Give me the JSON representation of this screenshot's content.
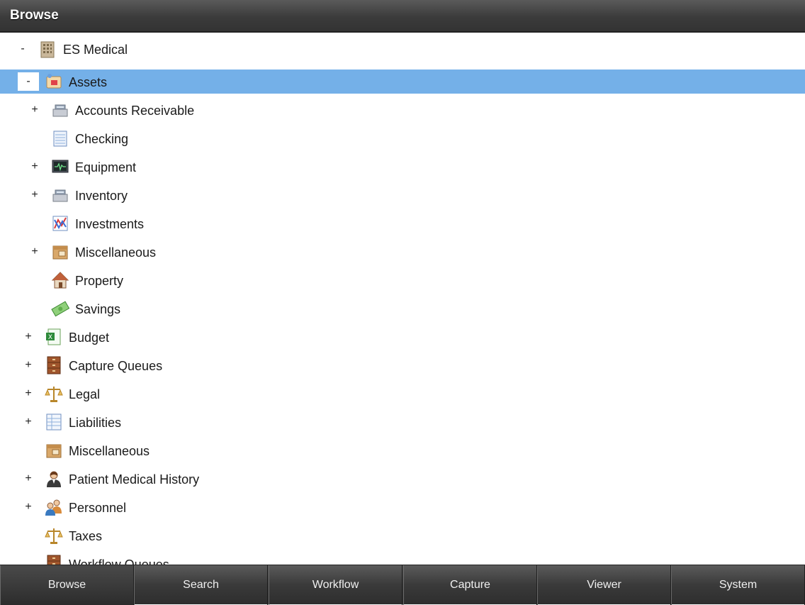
{
  "header": {
    "title": "Browse"
  },
  "tree": {
    "root": {
      "label": "ES Medical",
      "toggle": "-",
      "icon": "building-icon"
    },
    "items": [
      {
        "label": "Assets",
        "toggle": "-",
        "icon": "assets-icon",
        "selected": true
      },
      {
        "label": "Accounts Receivable",
        "toggle": "+",
        "icon": "cash-register-icon"
      },
      {
        "label": "Checking",
        "toggle": "",
        "icon": "ledger-icon"
      },
      {
        "label": "Equipment",
        "toggle": "+",
        "icon": "monitor-icon"
      },
      {
        "label": "Inventory",
        "toggle": "+",
        "icon": "cash-register-icon"
      },
      {
        "label": "Investments",
        "toggle": "",
        "icon": "chart-icon"
      },
      {
        "label": "Miscellaneous",
        "toggle": "+",
        "icon": "box-icon"
      },
      {
        "label": "Property",
        "toggle": "",
        "icon": "house-icon"
      },
      {
        "label": "Savings",
        "toggle": "",
        "icon": "money-icon"
      },
      {
        "label": "Budget",
        "toggle": "+",
        "icon": "spreadsheet-icon"
      },
      {
        "label": "Capture Queues",
        "toggle": "+",
        "icon": "cabinet-icon"
      },
      {
        "label": "Legal",
        "toggle": "+",
        "icon": "scales-icon"
      },
      {
        "label": "Liabilities",
        "toggle": "+",
        "icon": "table-doc-icon"
      },
      {
        "label": "Miscellaneous",
        "toggle": "",
        "icon": "box-icon"
      },
      {
        "label": "Patient Medical History",
        "toggle": "+",
        "icon": "doctor-icon"
      },
      {
        "label": "Personnel",
        "toggle": "+",
        "icon": "people-icon"
      },
      {
        "label": "Taxes",
        "toggle": "",
        "icon": "scales-icon"
      },
      {
        "label": "Workflow Queues",
        "toggle": "",
        "icon": "cabinet-icon"
      }
    ]
  },
  "tabs": [
    {
      "label": "Browse",
      "active": true
    },
    {
      "label": "Search"
    },
    {
      "label": "Workflow"
    },
    {
      "label": "Capture"
    },
    {
      "label": "Viewer"
    },
    {
      "label": "System"
    }
  ],
  "colors": {
    "selection": "#74b0e8",
    "header": "#3b3b3b",
    "tabbar": "#3a3a3a"
  }
}
